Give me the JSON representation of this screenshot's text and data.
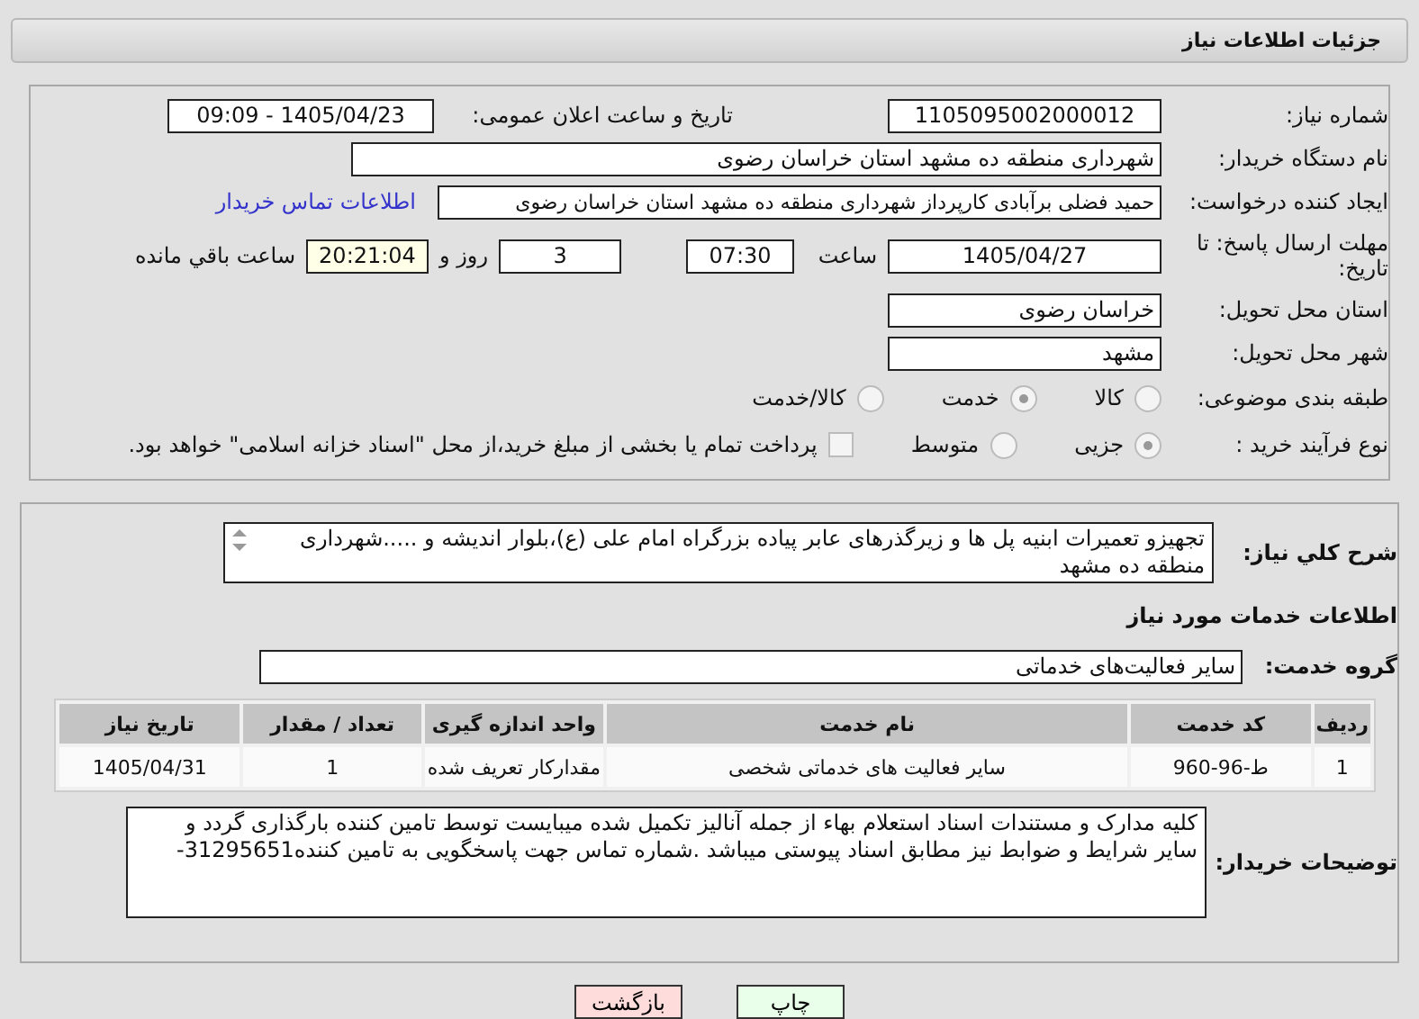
{
  "header": {
    "title": "جزئیات اطلاعات نیاز"
  },
  "need_number": {
    "label": "شماره نیاز:",
    "value": "1105095002000012"
  },
  "announce": {
    "label": "تاریخ و ساعت اعلان عمومی:",
    "value": "1405/04/23 - 09:09"
  },
  "buyer": {
    "label": "نام دستگاه خریدار:",
    "value": "شهرداری منطقه ده مشهد استان خراسان رضوی"
  },
  "creator": {
    "label": "ایجاد کننده درخواست:",
    "value": "حمید فضلی برآبادی کارپرداز شهرداری منطقه ده مشهد استان خراسان رضوی",
    "link": "اطلاعات تماس خریدار"
  },
  "deadline": {
    "label": "مهلت ارسال پاسخ: تا تاریخ:",
    "date": "1405/04/27",
    "time_label": "ساعت",
    "time": "07:30",
    "days": "3",
    "days_label": "روز و",
    "remaining": "20:21:04",
    "remaining_label": "ساعت باقي مانده"
  },
  "province": {
    "label": "استان محل تحویل:",
    "value": "خراسان رضوی"
  },
  "city": {
    "label": "شهر محل تحویل:",
    "value": "مشهد"
  },
  "category": {
    "label": "طبقه بندی موضوعی:",
    "options": [
      {
        "label": "کالا",
        "selected": false
      },
      {
        "label": "خدمت",
        "selected": true
      },
      {
        "label": "کالا/خدمت",
        "selected": false
      }
    ]
  },
  "process": {
    "label": "نوع فرآیند خرید :",
    "options": [
      {
        "label": "جزیی",
        "selected": true
      },
      {
        "label": "متوسط",
        "selected": false
      }
    ],
    "treasury": {
      "label": "پرداخت تمام یا بخشی از مبلغ خرید،از محل \"اسناد خزانه اسلامی\" خواهد بود.",
      "checked": false
    }
  },
  "description": {
    "label": "شرح کلي نیاز:",
    "value": "تجهیزو تعمیرات ابنیه پل ها و زیرگذرهای عابر پیاده بزرگراه امام علی (ع)،بلوار اندیشه و .....شهرداری منطقه ده مشهد"
  },
  "services_heading": "اطلاعات خدمات مورد نیاز",
  "service_group": {
    "label": "گروه خدمت:",
    "value": "سایر فعالیت‌های خدماتی"
  },
  "table": {
    "columns": [
      "ردیف",
      "کد خدمت",
      "نام خدمت",
      "واحد اندازه گیری",
      "تعداد / مقدار",
      "تاریخ نیاز"
    ],
    "rows": [
      [
        "1",
        "ط-96-960",
        "سایر فعالیت های خدماتی شخصی",
        "مقدارکار تعریف شده",
        "1",
        "1405/04/31"
      ]
    ]
  },
  "buyer_notes": {
    "label": "توضیحات خریدار:",
    "value": "کلیه مدارک و مستندات اسناد استعلام بهاء  از جمله آنالیز تکمیل شده میبایست توسط تامین کننده بارگذاری گردد و سایر شرایط و ضوابط نیز مطابق اسناد پیوستی میباشد .شماره تماس جهت پاسخگویی به تامین کننده31295651-"
  },
  "buttons": [
    {
      "label": "چاپ",
      "kind": "print"
    },
    {
      "label": "بازگشت",
      "kind": "back"
    }
  ]
}
